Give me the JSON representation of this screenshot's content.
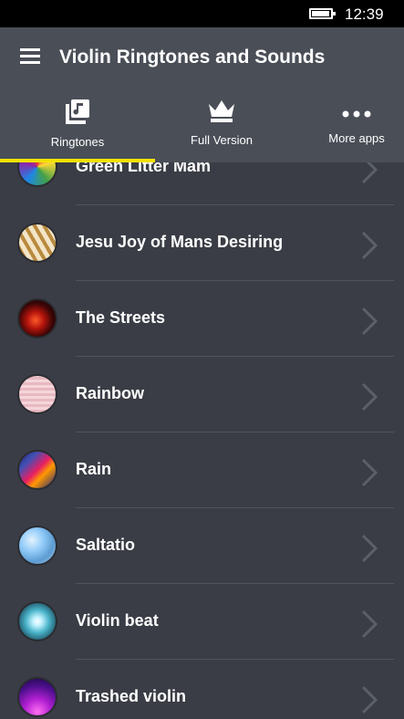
{
  "status_bar": {
    "time": "12:39",
    "battery_icon": "battery-icon"
  },
  "header": {
    "menu_icon": "hamburger-menu-icon",
    "title": "Violin Ringtones and Sounds",
    "background": "#4a4e57"
  },
  "tabs": [
    {
      "label": "Ringtones",
      "icon": "music-playlist-icon",
      "selected": true
    },
    {
      "label": "Full Version",
      "icon": "crown-icon",
      "selected": false
    },
    {
      "label": "More apps",
      "icon": "more-dots-icon",
      "selected": false
    }
  ],
  "accent_color": "#f2e200",
  "ringtones": [
    {
      "title": "Green Litter Mam",
      "thumbnail": "rainbow-swirl-thumbnail"
    },
    {
      "title": "Jesu Joy of Mans Desiring",
      "thumbnail": "diagonal-stripes-thumbnail"
    },
    {
      "title": "The Streets",
      "thumbnail": "red-swirl-thumbnail"
    },
    {
      "title": "Rainbow",
      "thumbnail": "pink-texture-thumbnail"
    },
    {
      "title": "Rain",
      "thumbnail": "colorful-streaks-thumbnail"
    },
    {
      "title": "Saltatio",
      "thumbnail": "blue-marble-thumbnail"
    },
    {
      "title": "Violin beat",
      "thumbnail": "glowing-orb-thumbnail"
    },
    {
      "title": "Trashed violin",
      "thumbnail": "purple-rays-thumbnail"
    }
  ],
  "chevron_icon": "chevron-right-icon"
}
